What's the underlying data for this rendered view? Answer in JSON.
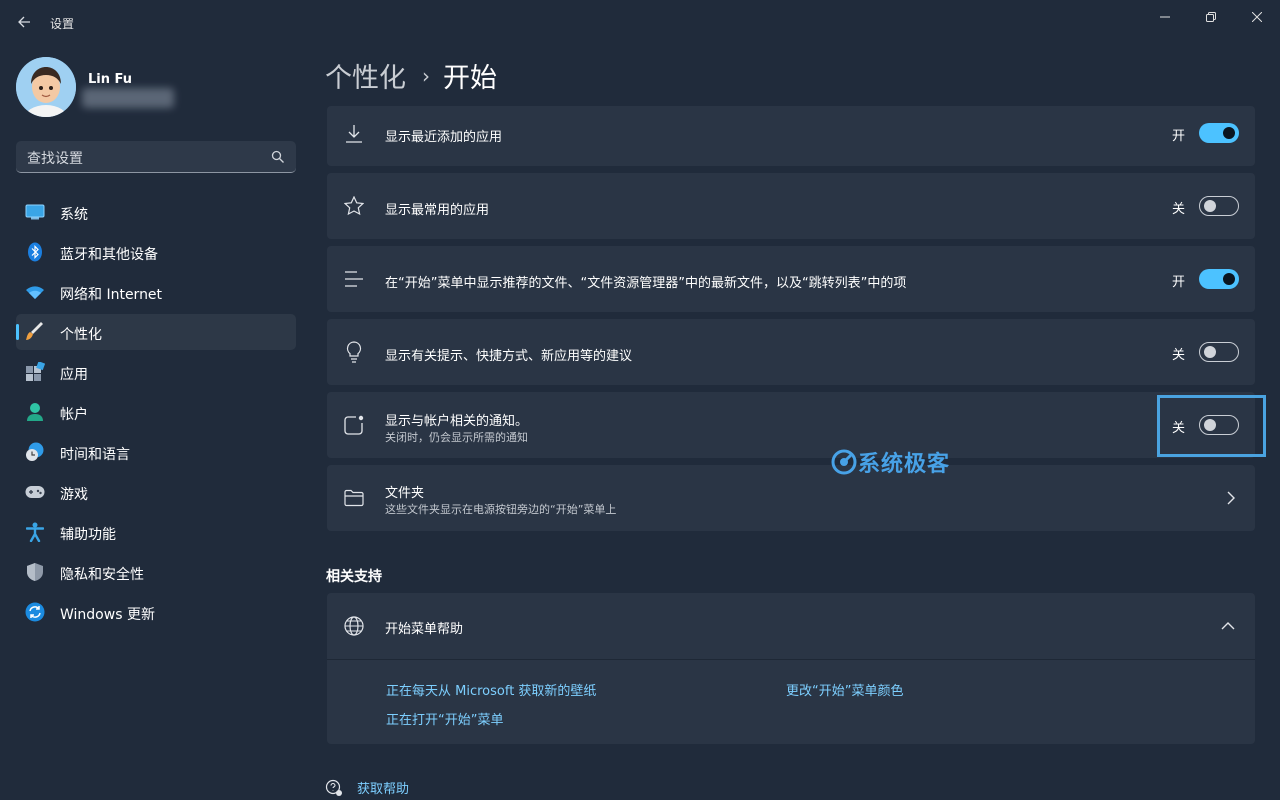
{
  "window": {
    "title": "设置",
    "controls": {
      "minimize": "minimize-icon",
      "restore": "restore-icon",
      "close": "close-icon"
    }
  },
  "profile": {
    "name": "Lin Fu"
  },
  "search": {
    "placeholder": "查找设置"
  },
  "sidebar": {
    "items": [
      {
        "label": "系统",
        "icon": "system-icon",
        "active": false
      },
      {
        "label": "蓝牙和其他设备",
        "icon": "bluetooth-icon",
        "active": false
      },
      {
        "label": "网络和 Internet",
        "icon": "wifi-icon",
        "active": false
      },
      {
        "label": "个性化",
        "icon": "brush-icon",
        "active": true
      },
      {
        "label": "应用",
        "icon": "apps-icon",
        "active": false
      },
      {
        "label": "帐户",
        "icon": "account-icon",
        "active": false
      },
      {
        "label": "时间和语言",
        "icon": "time-language-icon",
        "active": false
      },
      {
        "label": "游戏",
        "icon": "gamepad-icon",
        "active": false
      },
      {
        "label": "辅助功能",
        "icon": "accessibility-icon",
        "active": false
      },
      {
        "label": "隐私和安全性",
        "icon": "shield-icon",
        "active": false
      },
      {
        "label": "Windows 更新",
        "icon": "windows-update-icon",
        "active": false
      }
    ]
  },
  "header": {
    "parent": "个性化",
    "separator": "›",
    "current": "开始"
  },
  "settings": [
    {
      "title": "显示最近添加的应用",
      "state": "开",
      "on": true,
      "icon": "download-icon"
    },
    {
      "title": "显示最常用的应用",
      "state": "关",
      "on": false,
      "icon": "star-icon"
    },
    {
      "title": "在“开始”菜单中显示推荐的文件、“文件资源管理器”中的最新文件，以及“跳转列表”中的项",
      "state": "开",
      "on": true,
      "icon": "list-icon"
    },
    {
      "title": "显示有关提示、快捷方式、新应用等的建议",
      "state": "关",
      "on": false,
      "icon": "lightbulb-icon"
    },
    {
      "title": "显示与帐户相关的通知。",
      "subtitle": "关闭时，仍会显示所需的通知",
      "state": "关",
      "on": false,
      "icon": "notification-icon"
    }
  ],
  "folders": {
    "title": "文件夹",
    "subtitle": "这些文件夹显示在电源按钮旁边的“开始”菜单上",
    "icon": "folder-icon"
  },
  "watermark": {
    "text": "系统极客"
  },
  "related": {
    "section_title": "相关支持",
    "help_title": "开始菜单帮助",
    "links": [
      "正在每天从 Microsoft 获取新的壁纸",
      "更改“开始”菜单颜色",
      "正在打开“开始”菜单"
    ]
  },
  "bottom": {
    "get_help": "获取帮助"
  },
  "colors": {
    "accent": "#4cc2ff",
    "background": "#202b3b",
    "card": "#2a3545",
    "highlight": "#4aa3e0"
  }
}
